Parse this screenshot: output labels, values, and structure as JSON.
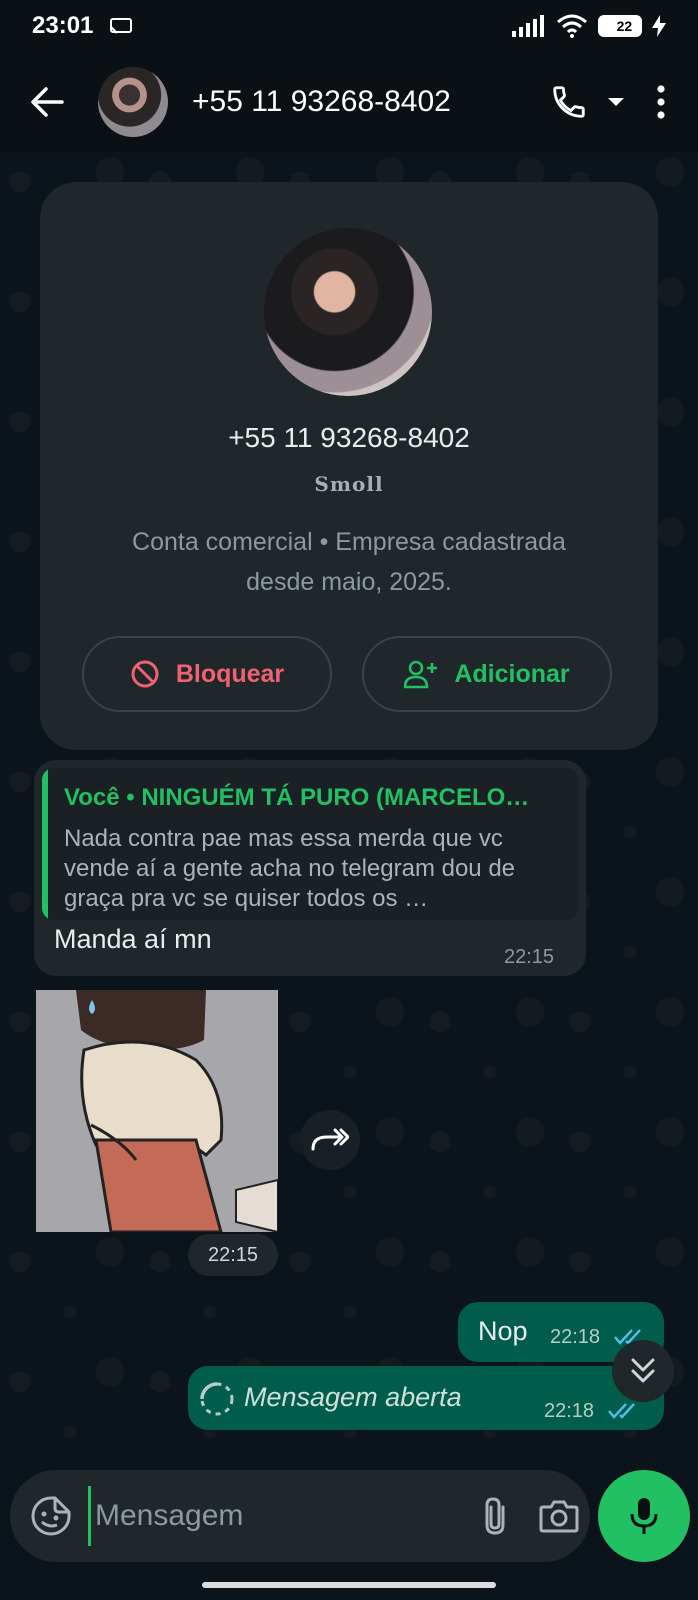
{
  "status_bar": {
    "time": "23:01",
    "battery": "22",
    "colors": {
      "battery_level": "#2fcf5e"
    }
  },
  "header": {
    "title": "+55 11 93268-8402"
  },
  "contact_card": {
    "number": "+55 11 93268-8402",
    "name": "Smoll",
    "info": "Conta comercial • Empresa cadastrada desde maio, 2025.",
    "block_label": "Bloquear",
    "add_label": "Adicionar"
  },
  "messages": {
    "quoted": {
      "author": "Você • NINGUÉM TÁ PURO (MARCELO…",
      "text": "Nada contra pae mas essa merda que vc vende aí a gente acha no telegram dou de graça pra vc se quiser todos os …"
    },
    "incoming_text": "Manda aí mn",
    "incoming_time": "22:15",
    "sticker_time": "22:15",
    "nop_text": "Nop",
    "nop_time": "22:18",
    "opened_text": "Mensagem aberta",
    "opened_time": "22:18"
  },
  "composer": {
    "placeholder": "Mensagem"
  },
  "colors": {
    "accent": "#21c063",
    "danger": "#f06272",
    "outgoing_bubble": "#005c4b",
    "incoming_bubble": "#1f272a",
    "read_ticks": "#53bdeb"
  }
}
